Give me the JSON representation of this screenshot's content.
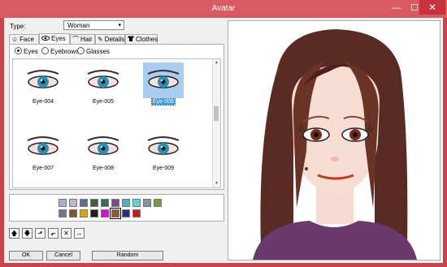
{
  "window": {
    "title": "Avatar",
    "minimize": "—",
    "maximize": "☐",
    "close": "✕"
  },
  "type": {
    "label": "Type:",
    "value": "Woman",
    "caret": "▾"
  },
  "tabs": [
    {
      "label": "Face",
      "icon": "☺"
    },
    {
      "label": "Eyes",
      "icon": "👁"
    },
    {
      "label": "Hair",
      "icon": "⌒"
    },
    {
      "label": "Details",
      "icon": "✎"
    },
    {
      "label": "Clothes",
      "icon": "👕"
    }
  ],
  "radios": [
    {
      "label": "Eyes",
      "checked": true
    },
    {
      "label": "Eyebrows",
      "checked": false
    },
    {
      "label": "Glasses",
      "checked": false
    }
  ],
  "eyes": [
    {
      "label": "Eye-004",
      "selected": false
    },
    {
      "label": "Eye-005",
      "selected": false
    },
    {
      "label": "Eye-006",
      "selected": true
    },
    {
      "label": "Eye-007",
      "selected": false
    },
    {
      "label": "Eye-008",
      "selected": false
    },
    {
      "label": "Eye-009",
      "selected": false
    }
  ],
  "palette": {
    "row1": [
      "#9bb3d6",
      "#b5b9c8",
      "#5f6f86",
      "#4e5a3d",
      "#2f6f5e",
      "#7a4c8c",
      "#4fb1c4",
      "#5dd3d3",
      "#7a9a9a",
      "#789a3a"
    ],
    "row2": [
      "#6d7a9a",
      "#7a5a2a",
      "#d8a800",
      "#1f1f1f",
      "#e000e0",
      "#8a5a3a",
      "#2a2a8a",
      "#c41a1a"
    ],
    "selected_row": 2,
    "selected_index": 5
  },
  "tools": {
    "up": "🡅",
    "down": "🡇",
    "out_tr": "⬏",
    "out_bl": "⬐",
    "flip_x": "✕",
    "flip_h": "↔"
  },
  "buttons": {
    "ok": "OK",
    "cancel": "Cancel",
    "random": "Random"
  },
  "colors": {
    "titlebar": "#d85a62",
    "selection": "#3399ff",
    "iris": "#2a8fb0"
  }
}
